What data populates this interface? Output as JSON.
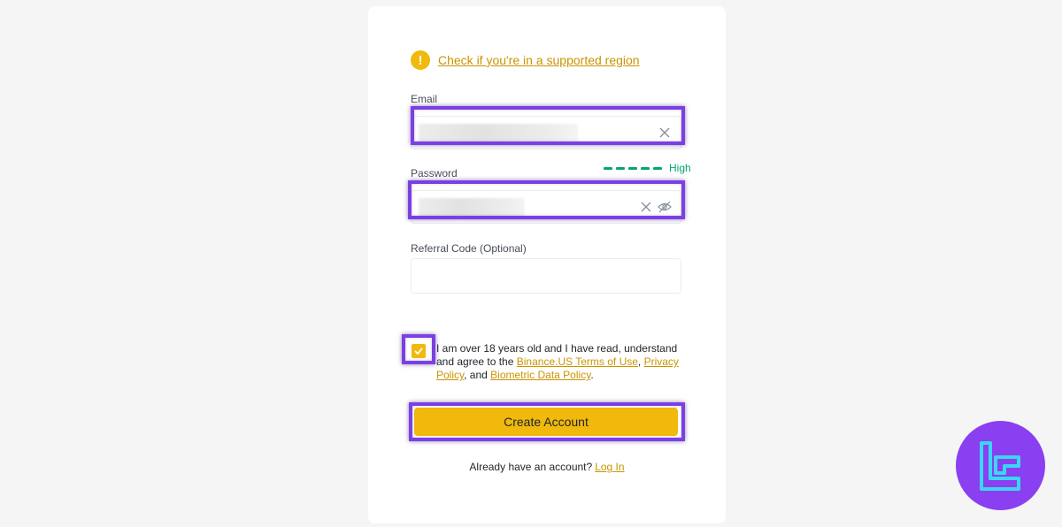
{
  "region_check": {
    "link_text": "Check if you're in a supported region",
    "icon": "warning-icon"
  },
  "email": {
    "label": "Email",
    "value": "",
    "clear_icon": "close-icon"
  },
  "password": {
    "label": "Password",
    "value": "",
    "strength_label": "High",
    "clear_icon": "close-icon",
    "visibility_icon": "eye-off-icon"
  },
  "referral": {
    "label": "Referral Code (Optional)",
    "value": ""
  },
  "terms": {
    "checked": true,
    "text_before": "I am over 18 years old and I have read, understand and agree to the ",
    "terms_link": "Binance.US Terms of Use",
    "sep1": ", ",
    "privacy_link": "Privacy Policy",
    "sep2": ", and ",
    "biometric_link": "Biometric Data Policy",
    "text_after": "."
  },
  "create_button": {
    "label": "Create Account"
  },
  "login": {
    "prompt": "Already have an account?",
    "link": "Log In"
  },
  "colors": {
    "accent": "#f0b90b",
    "link": "#c99400",
    "highlight": "#7b3fe4",
    "strength": "#03a66d",
    "badge": "#8a3ff0",
    "badge_logo": "#3ad6f5"
  }
}
